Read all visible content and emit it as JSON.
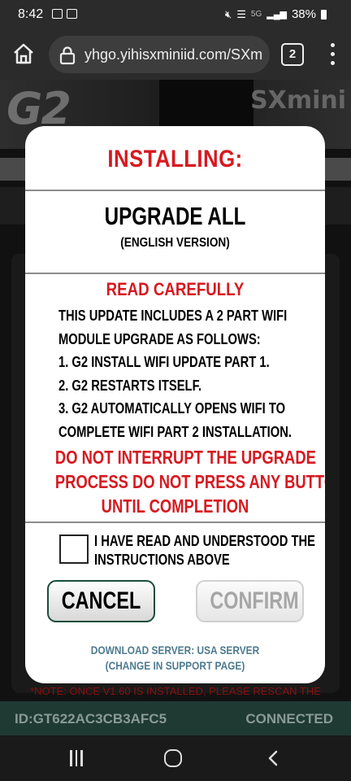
{
  "status_bar": {
    "time": "8:42",
    "network": "5G",
    "battery": "38%"
  },
  "browser": {
    "url": "yhgo.yihisxminiid.com/SXm",
    "tab_count": "2"
  },
  "background_page": {
    "logo": "G2",
    "brand": "SXmini",
    "note": "*NOTE: ONCE V1.60 IS INSTALLED, PLEASE RESCAN THE",
    "device_id": "ID:GT622AC3CB3AFC5",
    "connection_status": "CONNECTED"
  },
  "modal": {
    "title": "INSTALLING:",
    "upgrade_name": "UPGRADE ALL",
    "version": "(ENGLISH VERSION)",
    "read_carefully": "READ CAREFULLY",
    "instructions": [
      "THIS UPDATE INCLUDES A 2 PART WIFI",
      "MODULE UPGRADE AS FOLLOWS:",
      "1. G2 INSTALL WIFI UPDATE PART 1.",
      "2. G2 RESTARTS ITSELF.",
      "3. G2 AUTOMATICALLY OPENS WIFI TO",
      "COMPLETE WIFI PART 2 INSTALLATION."
    ],
    "warning": [
      "DO NOT INTERRUPT THE UPGRADE",
      "PROCESS DO NOT PRESS ANY BUTTON",
      "UNTIL COMPLETION"
    ],
    "checkbox_label": [
      "I HAVE READ AND UNDERSTOOD THE",
      "INSTRUCTIONS ABOVE"
    ],
    "cancel_label": "CANCEL",
    "confirm_label": "CONFIRM",
    "server_info": [
      "DOWNLOAD SERVER: USA SERVER",
      "(CHANGE IN SUPPORT PAGE)"
    ]
  },
  "colors": {
    "title_red": "#d71920",
    "server_blue": "#4d7a8f",
    "footer_green": "#1f3a33"
  },
  "icons": [
    "home-icon",
    "lock-icon",
    "more-vert-icon",
    "nav-recent-icon",
    "nav-home-icon",
    "nav-back-icon"
  ]
}
